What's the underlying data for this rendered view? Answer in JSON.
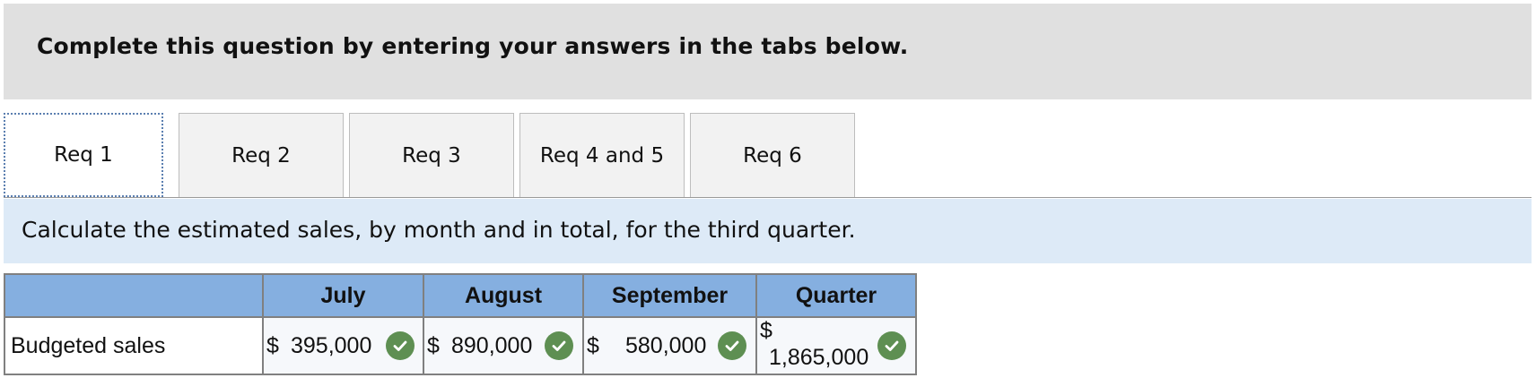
{
  "instructions": "Complete this question by entering your answers in the tabs below.",
  "tabs": [
    {
      "label": "Req 1",
      "active": true
    },
    {
      "label": "Req 2",
      "active": false
    },
    {
      "label": "Req 3",
      "active": false
    },
    {
      "label": "Req 4 and 5",
      "active": false
    },
    {
      "label": "Req 6",
      "active": false
    }
  ],
  "prompt": "Calculate the estimated sales, by month and in total, for the third quarter.",
  "table": {
    "headers": [
      "",
      "July",
      "August",
      "September",
      "Quarter"
    ],
    "row": {
      "label": "Budgeted sales",
      "cells": [
        {
          "currency": "$",
          "value": "395,000",
          "status": "correct"
        },
        {
          "currency": "$",
          "value": "890,000",
          "status": "correct"
        },
        {
          "currency": "$",
          "value": "580,000",
          "status": "correct"
        },
        {
          "currency": "$",
          "value": "1,865,000",
          "status": "correct"
        }
      ]
    }
  },
  "colors": {
    "header_fill": "#85afe0",
    "prompt_band": "#ddeaf7",
    "check_green": "#5e8f52",
    "instructions_band": "#e0e0e0"
  },
  "icons": {
    "correct": "checkmark-circle-icon"
  }
}
